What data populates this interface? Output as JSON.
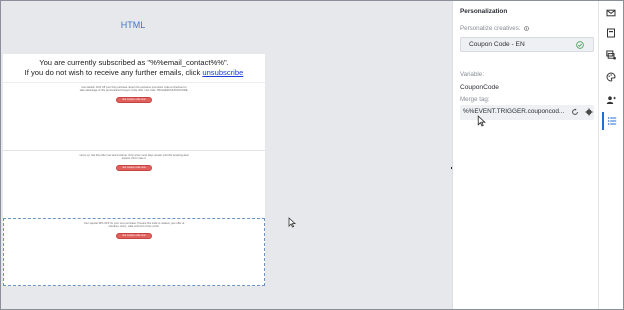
{
  "canvas": {
    "heading": "HTML",
    "subscription": {
      "line1": "You are currently subscribed as \"%%email_contact%%\".",
      "line2_prefix": "If you do not wish to receive any further emails, click ",
      "link": "unsubscribe"
    },
    "blocks": [
      {
        "text": "Get started: 10% Off your first purchase. Enter this exclusive promotion code at checkout to take advantage of this personalized Coupon Code offer. Use code: TRIGGERCOUPONCODE.",
        "button": "Get coupon code now"
      },
      {
        "text": "Hurry up: Get this offer now and continue. Only a few more days remain until this amazing deal expires. Don't miss it.",
        "button": "Get coupon code now"
      },
      {
        "text": "Your special 10% OFF for your next purchase. Present this code to redeem your offer at checkout. Hurry, valid until end of the month.",
        "button": "Get coupon code now"
      }
    ]
  },
  "panel": {
    "title": "Personalization",
    "personalize_label": "Personalize creatives:",
    "selected": "Coupon Code - EN",
    "variable_label": "Variable:",
    "variable_value": "CouponCode",
    "merge_label": "Merge tag:",
    "merge_value": "%%EVENT.TRIGGER.couponcod..."
  },
  "toolbar": {
    "items": [
      "mail-icon",
      "template-icon",
      "image-settings-icon",
      "palette-icon",
      "add-user-icon",
      "list-icon"
    ],
    "active": "list-icon"
  },
  "colors": {
    "accent": "#1f6fd6",
    "button": "#e0605d",
    "heading": "#3f74c4"
  }
}
